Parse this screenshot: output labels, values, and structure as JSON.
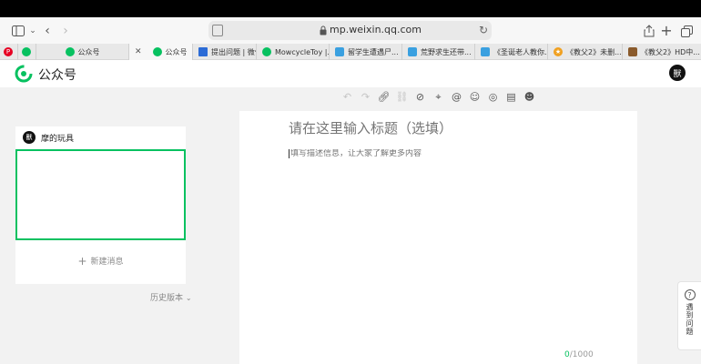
{
  "browser": {
    "url": "mp.weixin.qq.com"
  },
  "tabs": [
    {
      "label": "公众号",
      "icon": "wechat-mp-icon",
      "color": "#07c160"
    },
    {
      "label": "公众号",
      "icon": "wechat-mp-icon",
      "color": "#07c160",
      "active": true
    },
    {
      "label": "提出问题 | 微信...",
      "icon": "grid-icon",
      "color": "#2b6bd6"
    },
    {
      "label": "MowcycleToy |...",
      "icon": "wechat-icon",
      "color": "#07c160"
    },
    {
      "label": "留学生遭遇尸...",
      "icon": "bilibili-icon",
      "color": "#3aa0e0"
    },
    {
      "label": "荒野求生还带...",
      "icon": "bilibili-icon",
      "color": "#3aa0e0"
    },
    {
      "label": "《圣诞老人教你...",
      "icon": "bilibili-icon",
      "color": "#3aa0e0"
    },
    {
      "label": "《教父2》未删...",
      "icon": "star-icon",
      "color": "#f0a020"
    },
    {
      "label": "《教父2》HD中...",
      "icon": "film-icon",
      "color": "#8a5a2b"
    }
  ],
  "header": {
    "brand": "公众号",
    "brand_color": "#07c160",
    "avatar_text": "獸"
  },
  "sidebar": {
    "account_name": "摩的玩具",
    "account_avatar": "獸",
    "new_message": "新建消息",
    "history_version": "历史版本"
  },
  "editor": {
    "title_placeholder": "请在这里输入标题（选填）",
    "desc_placeholder": "填写描述信息，让大家了解更多内容",
    "counter_current": "0",
    "counter_total": "/1000"
  },
  "help": {
    "label": "遇到问题"
  }
}
